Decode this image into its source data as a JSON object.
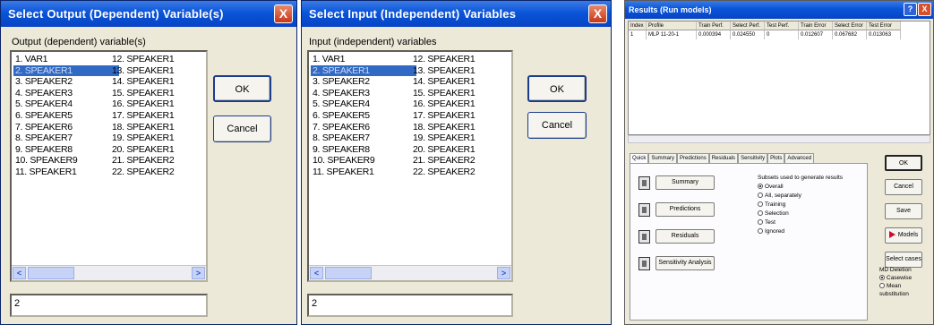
{
  "output_dialog": {
    "title": "Select Output (Dependent) Variable(s)",
    "close_glyph": "X",
    "list_label": "Output (dependent) variable(s)",
    "items_col1": [
      "1. VAR1",
      "2. SPEAKER1",
      "3. SPEAKER2",
      "4. SPEAKER3",
      "5. SPEAKER4",
      "6. SPEAKER5",
      "7. SPEAKER6",
      "8. SPEAKER7",
      "9. SPEAKER8",
      "10. SPEAKER9",
      "11. SPEAKER1"
    ],
    "items_col2": [
      "12. SPEAKER1",
      "13. SPEAKER1",
      "14. SPEAKER1",
      "15. SPEAKER1",
      "16. SPEAKER1",
      "17. SPEAKER1",
      "18. SPEAKER1",
      "19. SPEAKER1",
      "20. SPEAKER1",
      "21. SPEAKER2",
      "22. SPEAKER2"
    ],
    "selected_index": 1,
    "ok_label": "OK",
    "cancel_label": "Cancel",
    "selection_value": "2",
    "scroll_left": "<",
    "scroll_right": ">"
  },
  "input_dialog": {
    "title": "Select Input (Independent) Variables",
    "close_glyph": "X",
    "list_label": "Input (independent) variables",
    "items_col1": [
      "1. VAR1",
      "2. SPEAKER1",
      "3. SPEAKER2",
      "4. SPEAKER3",
      "5. SPEAKER4",
      "6. SPEAKER5",
      "7. SPEAKER6",
      "8. SPEAKER7",
      "9. SPEAKER8",
      "10. SPEAKER9",
      "11. SPEAKER1"
    ],
    "items_col2": [
      "12. SPEAKER1",
      "13. SPEAKER1",
      "14. SPEAKER1",
      "15. SPEAKER1",
      "16. SPEAKER1",
      "17. SPEAKER1",
      "18. SPEAKER1",
      "19. SPEAKER1",
      "20. SPEAKER1",
      "21. SPEAKER2",
      "22. SPEAKER2"
    ],
    "selected_index": 1,
    "ok_label": "OK",
    "cancel_label": "Cancel",
    "selection_value": "2",
    "scroll_left": "<",
    "scroll_right": ">"
  },
  "results_dialog": {
    "title": "Results (Run models)",
    "title_buttons": [
      "?",
      "X"
    ],
    "table_headers": [
      "Index",
      "Profile",
      "Train Perf.",
      "Select Perf.",
      "Test Perf.",
      "Train Error",
      "Select Error",
      "Test Error"
    ],
    "table_row": [
      "1",
      "MLP 11-20-1",
      "0.000394",
      "0.024550",
      "0",
      "0.012607",
      "0.067682",
      "0.013063"
    ],
    "tabs": [
      "Quick",
      "Summary",
      "Predictions",
      "Residuals",
      "Sensitivity",
      "Plots",
      "Advanced"
    ],
    "active_tab": "Quick",
    "panel_buttons": [
      "Summary",
      "Predictions",
      "Residuals",
      "Sensitivity Analysis"
    ],
    "subset_label": "Subsets used to generate results",
    "subset_options": [
      "Overall",
      "All, separately",
      "Training",
      "Selection",
      "Test",
      "Ignored"
    ],
    "subset_selected": "Overall",
    "side_buttons": [
      "OK",
      "Cancel",
      "Save",
      "Models",
      "Select cases"
    ],
    "md_label": "MD Deletion",
    "md_options": [
      "Casewise",
      "Mean substitution"
    ],
    "md_selected": "Casewise"
  }
}
